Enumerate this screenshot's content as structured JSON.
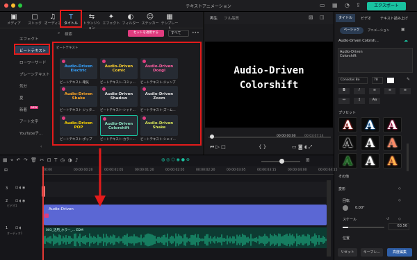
{
  "window": {
    "title": "テキストアニメーション",
    "export_label": "エクスポート"
  },
  "toolbar": {
    "items": [
      {
        "label": "メディア",
        "icon": "▣"
      },
      {
        "label": "ストック",
        "icon": "▢"
      },
      {
        "label": "オーディオ",
        "icon": "♫"
      },
      {
        "label": "タイトル",
        "icon": "T"
      },
      {
        "label": "トランジション",
        "icon": "⇆"
      },
      {
        "label": "エフェクト",
        "icon": "✦"
      },
      {
        "label": "フィルター",
        "icon": "◐"
      },
      {
        "label": "ステッカー",
        "icon": "☺"
      },
      {
        "label": "テンプレート",
        "icon": "▦"
      }
    ]
  },
  "categories": [
    "エフェクト",
    "ビートテキスト",
    "ローワーサード",
    "プレーンテキスト",
    "気分",
    "夏",
    "新着",
    "アート文字",
    "YouTubeチ..."
  ],
  "new_badge": "NEW",
  "search": {
    "placeholder": "検索",
    "set_button": "セットを適用する",
    "filter": "すべて"
  },
  "section_title": "ビートテキスト",
  "tiles": [
    {
      "text": "Audio-Driven Electric",
      "color": "#36a3ff",
      "caption": "ビートテキスト-電気"
    },
    {
      "text": "Audio-Driven Comic",
      "color": "#ffd12e",
      "caption": "ビートテキスト-コミッ..."
    },
    {
      "text": "Audio-Driven Doogl",
      "color": "#ff5fa2",
      "caption": "ビートテキスト-ジャンプ"
    },
    {
      "text": "Audio-Driven Shake",
      "color": "#ffa726",
      "caption": "ビートテキスト ジッタ..."
    },
    {
      "text": "Audio-Driven Shadow",
      "color": "#e0e0e0",
      "caption": "ビートテキスト-シャド..."
    },
    {
      "text": "Audio-Driven Zoom",
      "color": "#dddddd",
      "caption": "ビートテキスト-ズーム..."
    },
    {
      "text": "Audio-Driven POP",
      "color": "#ffd600",
      "caption": "ビートテキスト-ポップ"
    },
    {
      "text": "Audio-Driven Colorshift",
      "color": "#8be0c0",
      "caption": "ビートテキスト-カラー..."
    },
    {
      "text": "Audio-Driven Shake",
      "color": "#d4e157",
      "caption": "ビートテキスト-シェイ..."
    }
  ],
  "preview": {
    "tab": "再生",
    "quality": "フル品質",
    "text": "Audio-Driven\nColorshift",
    "current_time": "00:00:00:00",
    "total_time": "00:03:07:14"
  },
  "right": {
    "tabs": [
      "タイトル",
      "ビデオ",
      "テキスト読み上げ"
    ],
    "subtabs": [
      "ベーシック",
      "アニメーション"
    ],
    "clip_name": "Audio-Driven Colorsh...",
    "text_value": "Audio-Driven\nColorshift",
    "font": "Consolas Bo",
    "size": "78",
    "preset_label": "プリセット",
    "other_label": "その他",
    "transform_label": "変形",
    "rotate_label": "回転",
    "rotate_value": "0.00°",
    "scale_label": "スケール",
    "scale_value": "63.56",
    "position_label": "位置",
    "reset": "リセット",
    "keyframe": "キーフレ...",
    "advanced": "高度編集"
  },
  "timeline": {
    "times": [
      "00:00",
      "00:00:00:20",
      "00:00:01:05",
      "00:00:01:20",
      "00:00:02:05",
      "00:00:02:20",
      "00:00:03:05",
      "00:00:03:15",
      "00:00:04:00",
      "00:00:04:15"
    ],
    "title_clip": "Audio-Driven",
    "audio_clip": "003_活用_ホラー_... EDM",
    "track_video": "ビデオ1",
    "track_audio": "オーディオ1",
    "track_nums": [
      "3",
      "2",
      "1"
    ]
  }
}
